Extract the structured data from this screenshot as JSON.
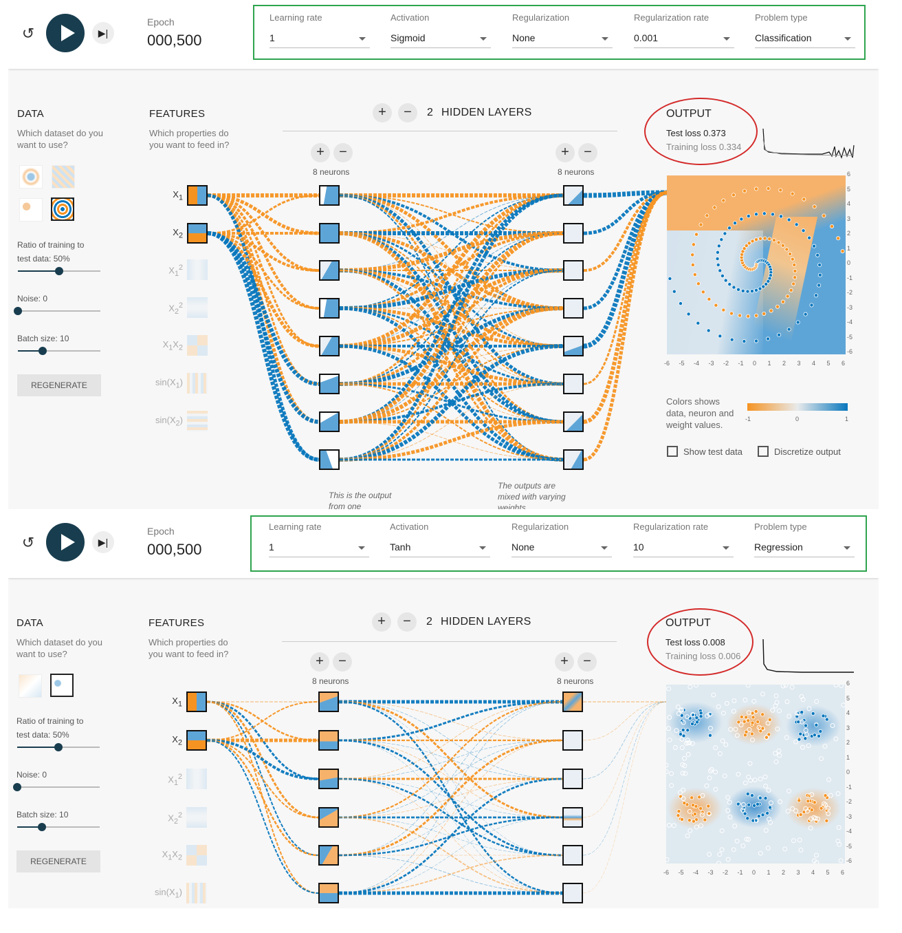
{
  "panels": [
    {
      "epoch_label": "Epoch",
      "epoch": "000,500",
      "controls": {
        "learning_rate": {
          "label": "Learning rate",
          "value": "1"
        },
        "activation": {
          "label": "Activation",
          "value": "Sigmoid"
        },
        "regularization": {
          "label": "Regularization",
          "value": "None"
        },
        "regularization_rate": {
          "label": "Regularization rate",
          "value": "0.001"
        },
        "problem_type": {
          "label": "Problem type",
          "value": "Classification"
        }
      },
      "data": {
        "title": "DATA",
        "subtitle": "Which dataset do you want to use?",
        "ratio_label": "Ratio of training to test data:  50%",
        "ratio": 0.5,
        "noise_label": "Noise:  0",
        "noise": 0,
        "batch_label": "Batch size:  10",
        "batch_fraction": 0.3,
        "regenerate": "REGENERATE"
      },
      "features": {
        "title": "FEATURES",
        "subtitle": "Which properties do you want to feed in?"
      },
      "network": {
        "hidden_layers_count": "2",
        "hidden_layers_label": "HIDDEN LAYERS",
        "layer1_neurons": "8 neurons",
        "layer2_neurons": "8 neurons",
        "note_left": "This is the output from one",
        "note_right": "The outputs are mixed with varying weights"
      },
      "output": {
        "title": "OUTPUT",
        "test_loss": "Test loss 0.373",
        "training_loss": "Training loss 0.334",
        "legend_text": "Colors shows data, neuron and weight values.",
        "cbar_min": "-1",
        "cbar_mid": "0",
        "cbar_max": "1",
        "show_test_data": "Show test data",
        "discretize_output": "Discretize output"
      }
    },
    {
      "epoch_label": "Epoch",
      "epoch": "000,500",
      "controls": {
        "learning_rate": {
          "label": "Learning rate",
          "value": "1"
        },
        "activation": {
          "label": "Activation",
          "value": "Tanh"
        },
        "regularization": {
          "label": "Regularization",
          "value": "None"
        },
        "regularization_rate": {
          "label": "Regularization rate",
          "value": "10"
        },
        "problem_type": {
          "label": "Problem type",
          "value": "Regression"
        }
      },
      "data": {
        "title": "DATA",
        "subtitle": "Which dataset do you want to use?",
        "ratio_label": "Ratio of training to test data:  50%",
        "ratio": 0.5,
        "noise_label": "Noise:  0",
        "noise": 0,
        "batch_label": "Batch size:  10",
        "batch_fraction": 0.3,
        "regenerate": "REGENERATE"
      },
      "features": {
        "title": "FEATURES",
        "subtitle": "Which properties do you want to feed in?"
      },
      "network": {
        "hidden_layers_count": "2",
        "hidden_layers_label": "HIDDEN LAYERS",
        "layer1_neurons": "8 neurons",
        "layer2_neurons": "8 neurons"
      },
      "output": {
        "title": "OUTPUT",
        "test_loss": "Test loss 0.008",
        "training_loss": "Training loss 0.006"
      }
    }
  ],
  "axis_ticks": [
    "-6",
    "-5",
    "-4",
    "-3",
    "-2",
    "-1",
    "0",
    "1",
    "2",
    "3",
    "4",
    "5",
    "6"
  ],
  "colors": {
    "orange": "#f59322",
    "blue": "#0877bd",
    "dark": "#183d4e",
    "highlight_green": "#2ea44f",
    "highlight_red": "#d42a2a"
  }
}
